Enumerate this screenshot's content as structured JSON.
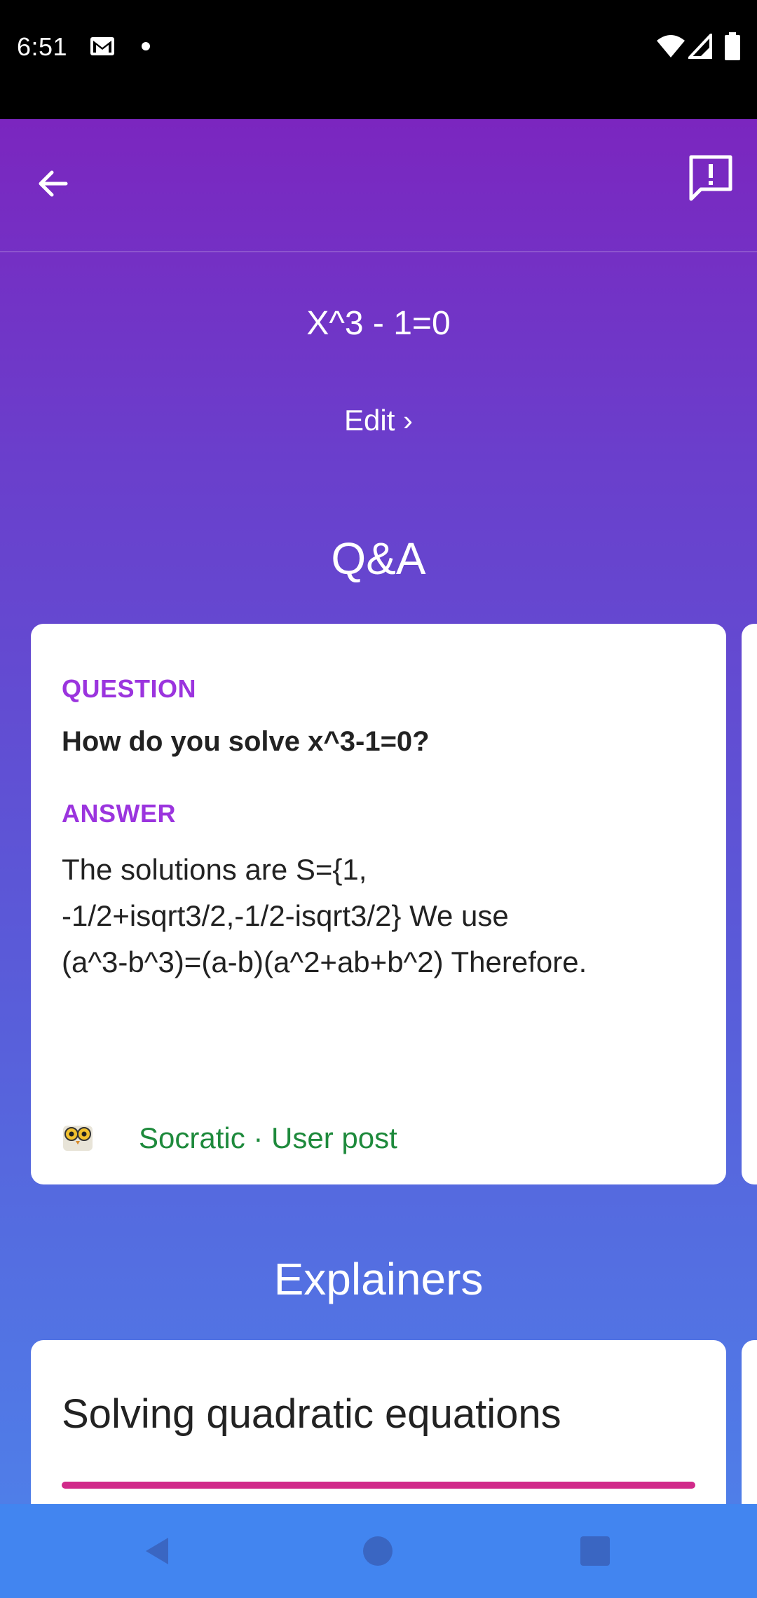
{
  "status_bar": {
    "time": "6:51",
    "icons": [
      "gmail-icon",
      "dot-icon",
      "wifi-icon",
      "signal-icon",
      "battery-icon"
    ]
  },
  "app_bar": {
    "back_icon": "arrow-back-icon",
    "feedback_icon": "feedback-icon"
  },
  "equation": "X^3 - 1=0",
  "edit_label": "Edit ›",
  "qa": {
    "title": "Q&A",
    "card": {
      "question_label": "QUESTION",
      "question": "How do you solve x^3-1=0?",
      "answer_label": "ANSWER",
      "answer_lines": [
        "The solutions are S={1,",
        "-1/2+isqrt3/2,-1/2-isqrt3/2} We use",
        "(a^3-b^3)=(a-b)(a^2+ab+b^2) Therefore."
      ],
      "source_icon": "owl-icon",
      "source": "Socratic · User post"
    }
  },
  "explainers": {
    "title": "Explainers",
    "card": {
      "title": "Solving quadratic equations"
    }
  },
  "colors": {
    "accent_purple": "#9b34de",
    "source_green": "#1e8a3c",
    "explainer_bar": "#d12a8a",
    "nav_bar": "#4285f0"
  }
}
